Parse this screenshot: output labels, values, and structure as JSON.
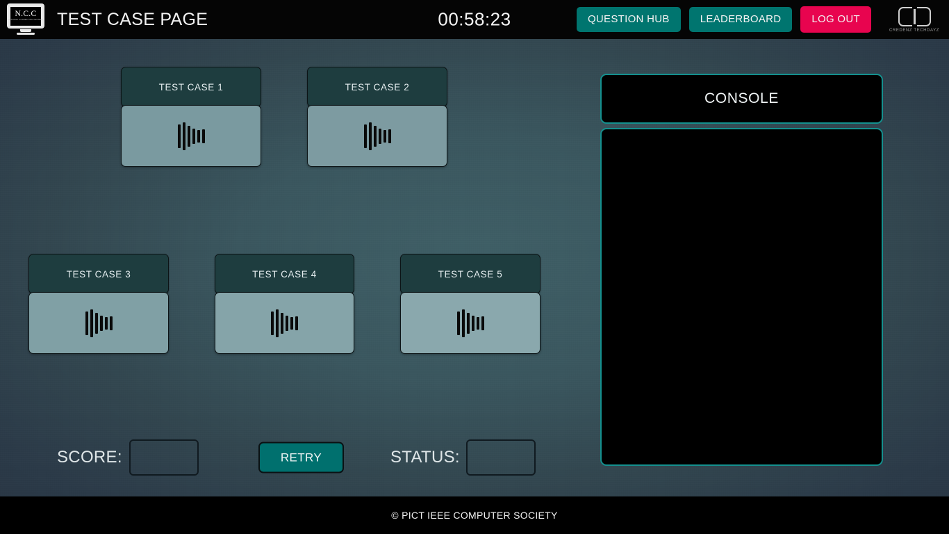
{
  "header": {
    "logo": {
      "name": "N.C.C",
      "subtitle": "NATIONAL CONNECTING CENTERS"
    },
    "title": "TEST CASE PAGE",
    "timer": "00:58:23",
    "buttons": [
      {
        "label": "QUESTION HUB",
        "style": "teal",
        "name": "question-hub-button"
      },
      {
        "label": "LEADERBOARD",
        "style": "teal",
        "name": "leaderboard-button"
      },
      {
        "label": "LOG OUT",
        "style": "pink",
        "name": "log-out-button"
      }
    ],
    "brand_logo": {
      "mark": "CTD",
      "caption": "CREDENZ TECHDAYZ"
    }
  },
  "test_cases": [
    {
      "label": "TEST CASE 1",
      "icon": "sound-wave-icon"
    },
    {
      "label": "TEST CASE 2",
      "icon": "sound-wave-icon"
    },
    {
      "label": "TEST CASE 3",
      "icon": "sound-wave-icon"
    },
    {
      "label": "TEST CASE 4",
      "icon": "sound-wave-icon"
    },
    {
      "label": "TEST CASE 5",
      "icon": "sound-wave-icon"
    }
  ],
  "console": {
    "title": "CONSOLE",
    "output": ""
  },
  "controls": {
    "score_label": "SCORE:",
    "score_value": "",
    "score_placeholder": "",
    "retry_label": "RETRY",
    "status_label": "STATUS:",
    "status_value": "",
    "status_placeholder": ""
  },
  "footer": {
    "copyright": "© PICT IEEE COMPUTER SOCIETY"
  },
  "colors": {
    "accent_teal": "#00756f",
    "danger_pink": "#e8044f",
    "console_border": "#14908e",
    "card_header": "#1e3d3f",
    "card_body": "#7a9aa0",
    "topbar": "#050505"
  }
}
